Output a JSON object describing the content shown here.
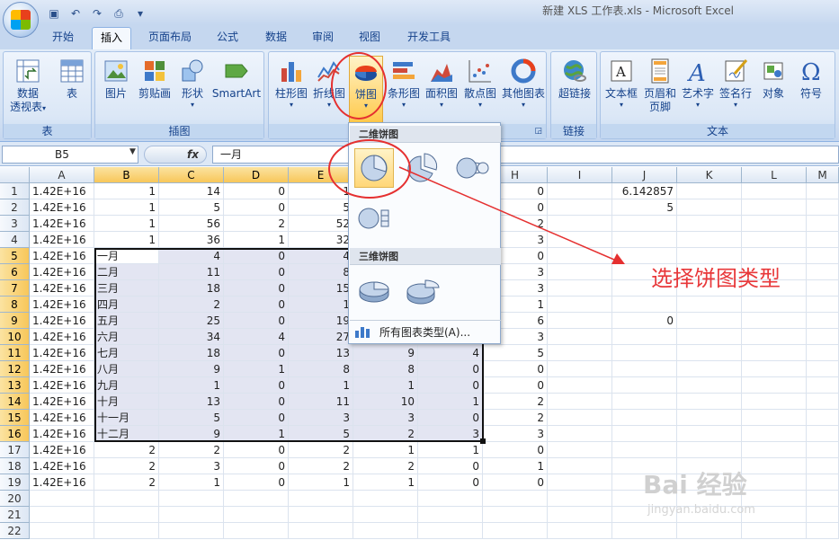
{
  "window": {
    "title": "新建 XLS 工作表.xls - Microsoft Excel"
  },
  "tabs": [
    "开始",
    "插入",
    "页面布局",
    "公式",
    "数据",
    "审阅",
    "视图",
    "开发工具"
  ],
  "active_tab": "插入",
  "ribbon": {
    "groups": {
      "table": {
        "label": "表",
        "pivot": "数据\n透视表",
        "pivot_l1": "数据",
        "pivot_l2": "透视表",
        "table": "表"
      },
      "illustrations": {
        "label": "插图",
        "picture": "图片",
        "clipart": "剪贴画",
        "shapes": "形状",
        "smartart": "SmartArt"
      },
      "charts": {
        "column": "柱形图",
        "line": "折线图",
        "pie": "饼图",
        "bar": "条形图",
        "area": "面积图",
        "scatter": "散点图",
        "other": "其他图表"
      },
      "links": {
        "label": "链接",
        "hyperlink": "超链接"
      },
      "text": {
        "label": "文本",
        "textbox": "文本框",
        "header_l1": "页眉和",
        "header_l2": "页脚",
        "wordart": "艺术字",
        "signature": "签名行",
        "object": "对象",
        "symbol": "符号"
      }
    }
  },
  "formula_bar": {
    "name_box": "B5",
    "fx": "fx",
    "value": "一月"
  },
  "columns": [
    "A",
    "B",
    "C",
    "D",
    "E",
    "F",
    "G",
    "H",
    "I",
    "J",
    "K",
    "L",
    "M"
  ],
  "rows": [
    [
      "1.42E+16",
      "1",
      "14",
      "0",
      "1",
      "",
      "",
      "0",
      "",
      "6.142857"
    ],
    [
      "1.42E+16",
      "1",
      "5",
      "0",
      "5",
      "",
      "",
      "0",
      "",
      "5"
    ],
    [
      "1.42E+16",
      "1",
      "56",
      "2",
      "52",
      "",
      "",
      "2",
      "",
      ""
    ],
    [
      "1.42E+16",
      "1",
      "36",
      "1",
      "32",
      "",
      "",
      "3",
      "",
      ""
    ],
    [
      "1.42E+16",
      "一月",
      "4",
      "0",
      "4",
      "",
      "",
      "0",
      "",
      ""
    ],
    [
      "1.42E+16",
      "二月",
      "11",
      "0",
      "8",
      "",
      "",
      "3",
      "",
      ""
    ],
    [
      "1.42E+16",
      "三月",
      "18",
      "0",
      "15",
      "",
      "",
      "3",
      "",
      ""
    ],
    [
      "1.42E+16",
      "四月",
      "2",
      "0",
      "1",
      "",
      "",
      "1",
      "",
      ""
    ],
    [
      "1.42E+16",
      "五月",
      "25",
      "0",
      "19",
      "",
      "",
      "6",
      "",
      "0"
    ],
    [
      "1.42E+16",
      "六月",
      "34",
      "4",
      "27",
      "",
      "",
      "3",
      "",
      ""
    ],
    [
      "1.42E+16",
      "七月",
      "18",
      "0",
      "13",
      "9",
      "4",
      "5",
      "",
      ""
    ],
    [
      "1.42E+16",
      "八月",
      "9",
      "1",
      "8",
      "8",
      "0",
      "0",
      "",
      ""
    ],
    [
      "1.42E+16",
      "九月",
      "1",
      "0",
      "1",
      "1",
      "0",
      "0",
      "",
      ""
    ],
    [
      "1.42E+16",
      "十月",
      "13",
      "0",
      "11",
      "10",
      "1",
      "2",
      "",
      ""
    ],
    [
      "1.42E+16",
      "十一月",
      "5",
      "0",
      "3",
      "3",
      "0",
      "2",
      "",
      ""
    ],
    [
      "1.42E+16",
      "十二月",
      "9",
      "1",
      "5",
      "2",
      "3",
      "3",
      "",
      ""
    ],
    [
      "1.42E+16",
      "2",
      "2",
      "0",
      "2",
      "1",
      "1",
      "0",
      "",
      ""
    ],
    [
      "1.42E+16",
      "2",
      "3",
      "0",
      "2",
      "2",
      "0",
      "1",
      "",
      ""
    ],
    [
      "1.42E+16",
      "2",
      "1",
      "0",
      "1",
      "1",
      "0",
      "0",
      "",
      ""
    ],
    [
      "",
      "",
      "",
      "",
      "",
      "",
      "",
      "",
      "",
      ""
    ],
    [
      "",
      "",
      "",
      "",
      "",
      "",
      "",
      "",
      "",
      ""
    ],
    [
      "",
      "",
      "",
      "",
      "",
      "",
      "",
      "",
      "",
      ""
    ]
  ],
  "dropdown": {
    "section_2d": "二维饼图",
    "section_3d": "三维饼图",
    "all_types": "所有图表类型(A)..."
  },
  "annotation": "选择饼图类型",
  "watermark": {
    "brand": "Bai 经验",
    "url": "jingyan.baidu.com"
  },
  "colors": {
    "accent_red": "#e53030",
    "selection_highlight": "#e3e5f2",
    "ribbon_text": "#15428b"
  }
}
